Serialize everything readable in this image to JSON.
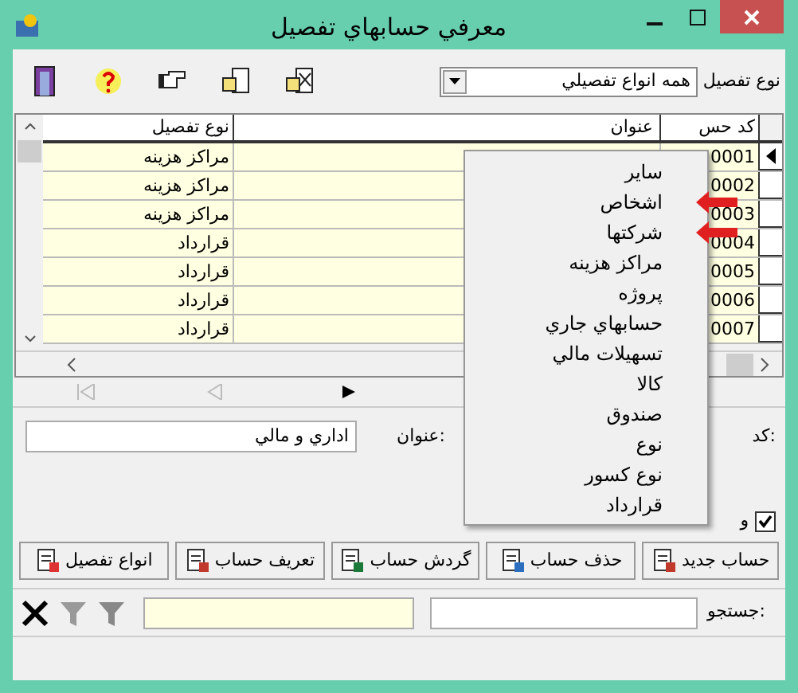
{
  "window": {
    "title": "معرفي حسابهاي تفصيل"
  },
  "filter": {
    "label": "نوع تفصيل",
    "value": "همه انواع تفصيلي"
  },
  "table": {
    "columns": [
      "کد حس",
      "عنوان",
      "نوع تفصيل"
    ],
    "rows": [
      {
        "type": "مراكز هزينه",
        "code": "0001",
        "selected": true
      },
      {
        "type": "مراكز هزينه",
        "code": "0002",
        "selected": false
      },
      {
        "type": "مراكز هزينه",
        "code": "0003",
        "selected": false
      },
      {
        "type": "قرارداد",
        "code": "0004",
        "selected": false
      },
      {
        "type": "قرارداد",
        "code": "0005",
        "selected": false
      },
      {
        "type": "قرارداد",
        "code": "0006",
        "selected": false
      },
      {
        "type": "قرارداد",
        "code": "0007",
        "selected": false
      }
    ]
  },
  "details": {
    "code_label": "کد:",
    "title_label": "عنوان:",
    "title_value": "اداري و مالي",
    "checkbox": {
      "label": "و",
      "checked": true
    }
  },
  "buttons": [
    "حساب جديد",
    "حذف حساب",
    "گردش حساب",
    "تعريف حساب",
    "انواع تفصيل"
  ],
  "search": {
    "label": "جستجو:"
  },
  "menu": {
    "items": [
      {
        "label": "ساير",
        "marked": false
      },
      {
        "label": "اشخاص",
        "marked": true
      },
      {
        "label": "شركتها",
        "marked": true
      },
      {
        "label": "مراكز هزينه",
        "marked": false
      },
      {
        "label": "پروژه",
        "marked": false
      },
      {
        "label": "حسابهاي جاري",
        "marked": false
      },
      {
        "label": "تسهيلات مالي",
        "marked": false
      },
      {
        "label": "كالا",
        "marked": false
      },
      {
        "label": "صندوق",
        "marked": false
      },
      {
        "label": "نوع",
        "marked": false
      },
      {
        "label": "نوع كسور",
        "marked": false
      },
      {
        "label": "قرارداد",
        "marked": false
      }
    ]
  }
}
